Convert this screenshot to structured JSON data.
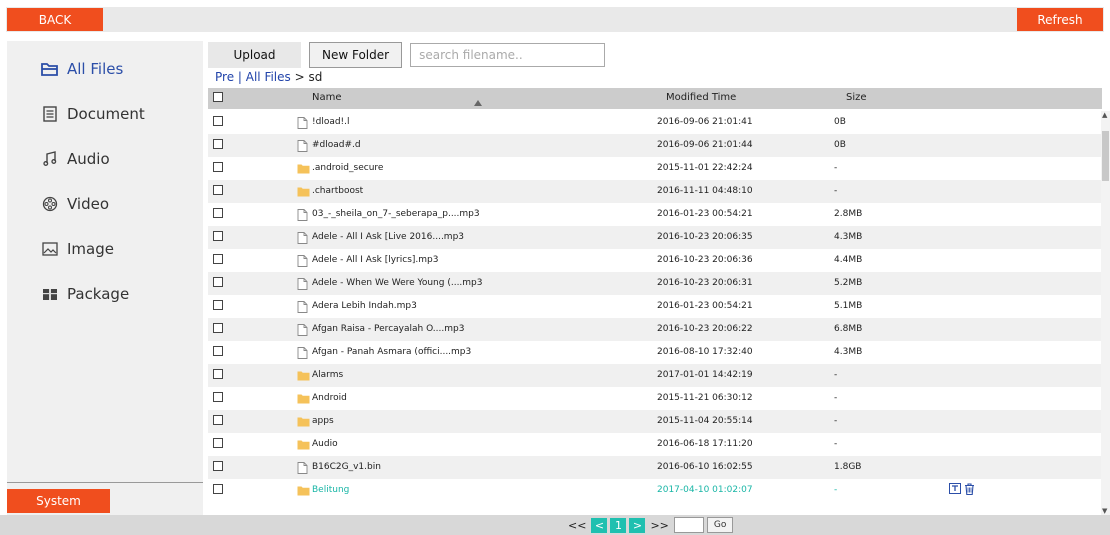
{
  "topbar": {
    "back_label": "BACK",
    "refresh_label": "Refresh"
  },
  "sidebar": {
    "items": [
      {
        "label": "All Files",
        "icon": "folder-open-icon",
        "active": true
      },
      {
        "label": "Document",
        "icon": "document-icon",
        "active": false
      },
      {
        "label": "Audio",
        "icon": "music-note-icon",
        "active": false
      },
      {
        "label": "Video",
        "icon": "video-reel-icon",
        "active": false
      },
      {
        "label": "Image",
        "icon": "image-icon",
        "active": false
      },
      {
        "label": "Package",
        "icon": "package-icon",
        "active": false
      }
    ],
    "system_label": "System"
  },
  "toolbar": {
    "upload_label": "Upload",
    "new_folder_label": "New Folder",
    "search_placeholder": "search filename.."
  },
  "breadcrumb": {
    "pre": "Pre",
    "sep": " | ",
    "all_files": "All Files",
    "arrow": " > ",
    "current": "sd"
  },
  "table": {
    "headers": {
      "name": "Name",
      "modified": "Modified Time",
      "size": "Size"
    },
    "rows": [
      {
        "type": "file",
        "name": "!dload!.l",
        "modified": "2016-09-06 21:01:41",
        "size": "0B"
      },
      {
        "type": "file",
        "name": "#dload#.d",
        "modified": "2016-09-06 21:01:44",
        "size": "0B"
      },
      {
        "type": "folder",
        "name": ".android_secure",
        "modified": "2015-11-01 22:42:24",
        "size": "-"
      },
      {
        "type": "folder",
        "name": ".chartboost",
        "modified": "2016-11-11 04:48:10",
        "size": "-"
      },
      {
        "type": "file",
        "name": "03_-_sheila_on_7-_seberapa_p....mp3",
        "modified": "2016-01-23 00:54:21",
        "size": "2.8MB"
      },
      {
        "type": "file",
        "name": "Adele - All I Ask [Live 2016....mp3",
        "modified": "2016-10-23 20:06:35",
        "size": "4.3MB"
      },
      {
        "type": "file",
        "name": "Adele - All I Ask [lyrics].mp3",
        "modified": "2016-10-23 20:06:36",
        "size": "4.4MB"
      },
      {
        "type": "file",
        "name": "Adele - When We Were Young (....mp3",
        "modified": "2016-10-23 20:06:31",
        "size": "5.2MB"
      },
      {
        "type": "file",
        "name": "Adera Lebih Indah.mp3",
        "modified": "2016-01-23 00:54:21",
        "size": "5.1MB"
      },
      {
        "type": "file",
        "name": "Afgan Raisa - Percayalah O....mp3",
        "modified": "2016-10-23 20:06:22",
        "size": "6.8MB"
      },
      {
        "type": "file",
        "name": "Afgan - Panah Asmara (offici....mp3",
        "modified": "2016-08-10 17:32:40",
        "size": "4.3MB"
      },
      {
        "type": "folder",
        "name": "Alarms",
        "modified": "2017-01-01 14:42:19",
        "size": "-"
      },
      {
        "type": "folder",
        "name": "Android",
        "modified": "2015-11-21 06:30:12",
        "size": "-"
      },
      {
        "type": "folder",
        "name": "apps",
        "modified": "2015-11-04 20:55:14",
        "size": "-"
      },
      {
        "type": "folder",
        "name": "Audio",
        "modified": "2016-06-18 17:11:20",
        "size": "-"
      },
      {
        "type": "file",
        "name": "B16C2G_v1.bin",
        "modified": "2016-06-10 16:02:55",
        "size": "1.8GB"
      },
      {
        "type": "folder",
        "name": "Belitung",
        "modified": "2017-04-10 01:02:07",
        "size": "-",
        "highlight": true
      }
    ]
  },
  "pager": {
    "first": "<<",
    "prev": "<",
    "page": "1",
    "next": ">",
    "last": ">>",
    "go": "Go"
  },
  "colors": {
    "accent_red": "#f04e1e",
    "teal": "#1fc0b0",
    "folder": "#f5c25a",
    "nav_blue": "#2b4ea8"
  }
}
